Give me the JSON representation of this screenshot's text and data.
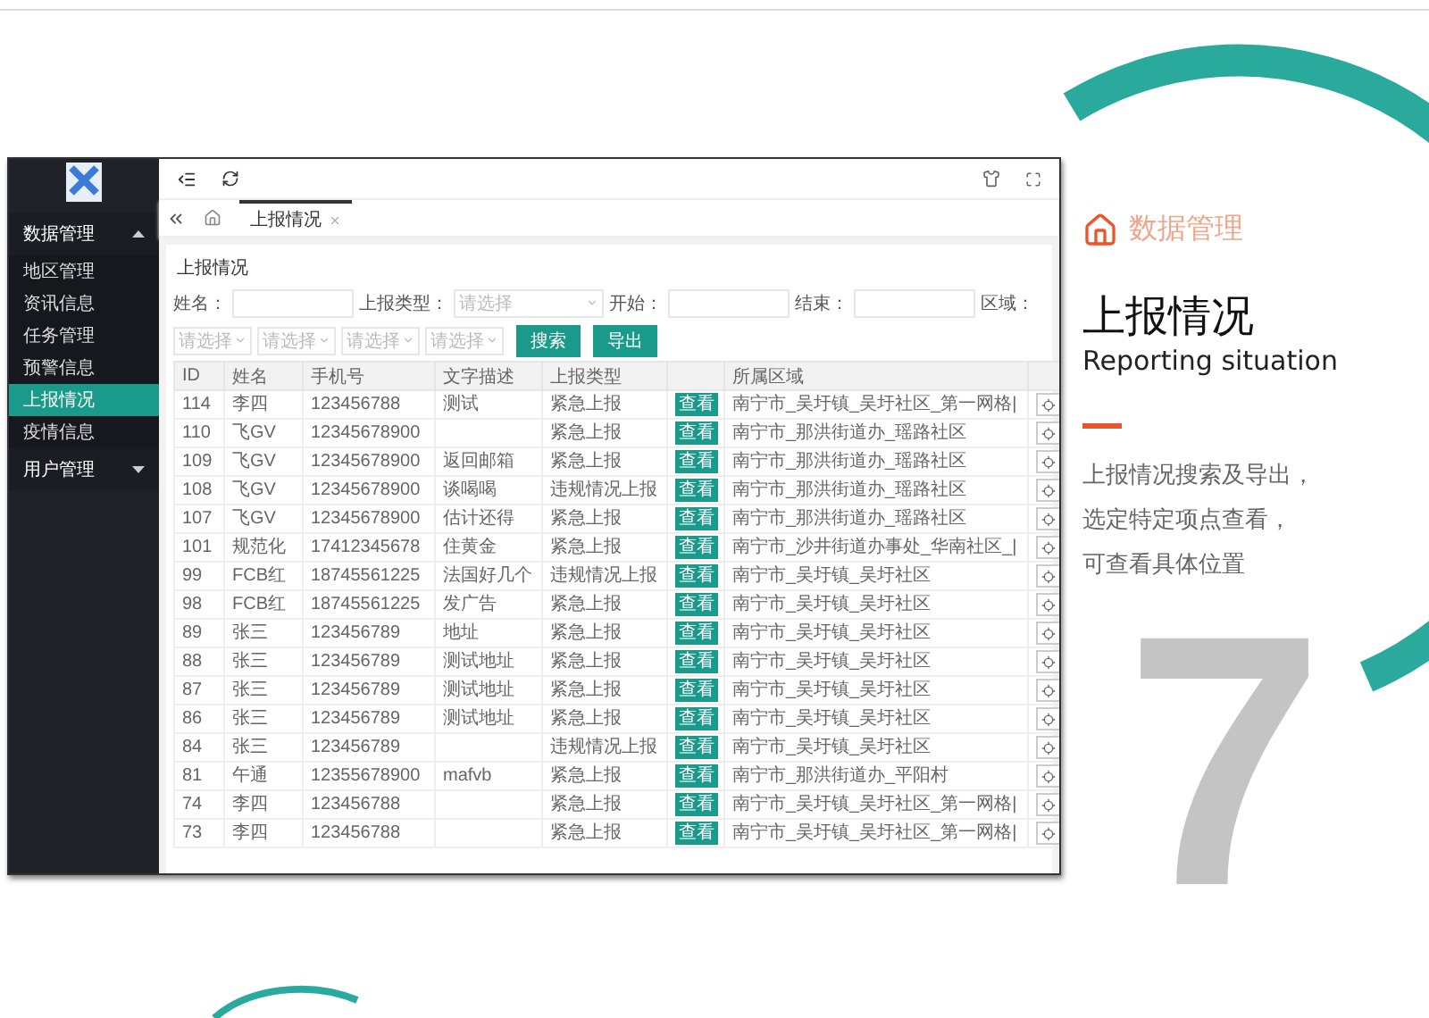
{
  "sidebar": {
    "groups": [
      {
        "label": "数据管理",
        "expanded": true,
        "children": [
          {
            "label": "地区管理",
            "selected": false
          },
          {
            "label": "资讯信息",
            "selected": false
          },
          {
            "label": "任务管理",
            "selected": false
          },
          {
            "label": "预警信息",
            "selected": false
          },
          {
            "label": "上报情况",
            "selected": true
          },
          {
            "label": "疫情信息",
            "selected": false
          }
        ]
      },
      {
        "label": "用户管理",
        "expanded": false
      }
    ]
  },
  "tabs": [
    {
      "label": "上报情况",
      "selected": true
    }
  ],
  "card_title": "上报情况",
  "filters": [
    {
      "label": "姓名：",
      "kind": "input"
    },
    {
      "label": "上报类型：",
      "kind": "select",
      "placeholder": "请选择"
    },
    {
      "label": "开始：",
      "kind": "input"
    },
    {
      "label": "结束：",
      "kind": "input"
    },
    {
      "label": "区域：",
      "kind": "label"
    }
  ],
  "selects": [
    {
      "placeholder": "请选择"
    },
    {
      "placeholder": "请选择"
    },
    {
      "placeholder": "请选择"
    },
    {
      "placeholder": "请选择"
    }
  ],
  "buttons": [
    {
      "label": "搜索"
    },
    {
      "label": "导出"
    }
  ],
  "table": {
    "columns": [
      "ID",
      "姓名",
      "手机号",
      "文字描述",
      "上报类型",
      "所属区域"
    ],
    "rows": [
      {
        "id": "114",
        "name": "李四",
        "phone": "123456788",
        "desc": "测试",
        "type": "紧急上报",
        "action": "查看",
        "region": "南宁市_吴圩镇_吴圩社区_第一网格|"
      },
      {
        "id": "110",
        "name": "飞GV",
        "phone": "12345678900",
        "type": "紧急上报",
        "action": "查看",
        "region": "南宁市_那洪街道办_瑶路社区"
      },
      {
        "id": "109",
        "name": "飞GV",
        "phone": "12345678900",
        "desc": "返回邮箱",
        "type": "紧急上报",
        "action": "查看",
        "region": "南宁市_那洪街道办_瑶路社区"
      },
      {
        "id": "108",
        "name": "飞GV",
        "phone": "12345678900",
        "desc": "谈喝喝",
        "type": "违规情况上报",
        "action": "查看",
        "region": "南宁市_那洪街道办_瑶路社区"
      },
      {
        "id": "107",
        "name": "飞GV",
        "phone": "12345678900",
        "desc": "估计还得",
        "type": "紧急上报",
        "action": "查看",
        "region": "南宁市_那洪街道办_瑶路社区"
      },
      {
        "id": "101",
        "name": "规范化",
        "phone": "17412345678",
        "desc": "住黄金",
        "type": "紧急上报",
        "action": "查看",
        "region": "南宁市_沙井街道办事处_华南社区_|"
      },
      {
        "id": "99",
        "name": "FCB红",
        "phone": "18745561225",
        "desc": "法国好几个",
        "type": "违规情况上报",
        "action": "查看",
        "region": "南宁市_吴圩镇_吴圩社区"
      },
      {
        "id": "98",
        "name": "FCB红",
        "phone": "18745561225",
        "desc": "发广告",
        "type": "紧急上报",
        "action": "查看",
        "region": "南宁市_吴圩镇_吴圩社区"
      },
      {
        "id": "89",
        "name": "张三",
        "phone": "123456789",
        "desc": "地址",
        "type": "紧急上报",
        "action": "查看",
        "region": "南宁市_吴圩镇_吴圩社区"
      },
      {
        "id": "88",
        "name": "张三",
        "phone": "123456789",
        "desc": "测试地址",
        "type": "紧急上报",
        "action": "查看",
        "region": "南宁市_吴圩镇_吴圩社区"
      },
      {
        "id": "87",
        "name": "张三",
        "phone": "123456789",
        "desc": "测试地址",
        "type": "紧急上报",
        "action": "查看",
        "region": "南宁市_吴圩镇_吴圩社区"
      },
      {
        "id": "86",
        "name": "张三",
        "phone": "123456789",
        "desc": "测试地址",
        "type": "紧急上报",
        "action": "查看",
        "region": "南宁市_吴圩镇_吴圩社区"
      },
      {
        "id": "84",
        "name": "张三",
        "phone": "123456789",
        "type": "违规情况上报",
        "action": "查看",
        "region": "南宁市_吴圩镇_吴圩社区"
      },
      {
        "id": "81",
        "name": "午通",
        "phone": "12355678900",
        "desc": "mafvb",
        "type": "紧急上报",
        "action": "查看",
        "region": "南宁市_那洪街道办_平阳村"
      },
      {
        "id": "74",
        "name": "李四",
        "phone": "123456788",
        "type": "紧急上报",
        "action": "查看",
        "region": "南宁市_吴圩镇_吴圩社区_第一网格|"
      },
      {
        "id": "73",
        "name": "李四",
        "phone": "123456788",
        "type": "紧急上报",
        "action": "查看",
        "region": "南宁市_吴圩镇_吴圩社区_第一网格|"
      }
    ]
  },
  "side_panel": {
    "section": "数据管理",
    "title": "上报情况",
    "subtitle": "Reporting situation",
    "description": [
      "上报情况搜索及导出，",
      "选定特定项点查看，",
      "可查看具体位置"
    ]
  },
  "page_number": "7"
}
